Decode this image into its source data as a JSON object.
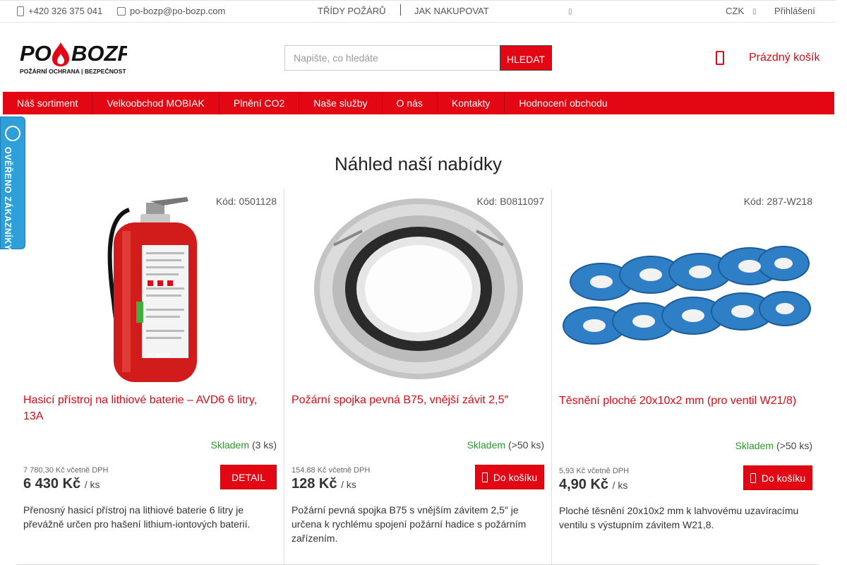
{
  "topbar": {
    "phone": "+420 326 375 041",
    "email": "po-bozp@po-bozp.com",
    "links": [
      "TŘÍDY POŽÁRŮ",
      "JAK NAKUPOVAT"
    ],
    "currency": "CZK",
    "login": "Přihlášení"
  },
  "header": {
    "logo_text": "PO BOZP",
    "logo_tagline": "POŽÁRNÍ OCHRANA | BEZPEČNOST PRÁCE",
    "search_placeholder": "Napište, co hledáte",
    "search_button": "HLEDAT",
    "cart_text": "Prázdný košík"
  },
  "nav": {
    "items": [
      "Náš sortiment",
      "Velkoobchod MOBIAK",
      "Plnění CO2",
      "Naše služby",
      "O nás",
      "Kontakty",
      "Hodnocení obchodu"
    ]
  },
  "badge": {
    "text": "OVĚŘENO ZÁKAZNÍKY"
  },
  "section_title": "Náhled naší nabídky",
  "products": [
    {
      "code": "Kód: 0501128",
      "name": "Hasicí přístroj na lithiové baterie – AVD6 6 litry, 13A",
      "stock_status": "Skladem",
      "stock_qty": "(3 ks)",
      "price_with_vat": "7 780,30 Kč včetně DPH",
      "price": "6 430 Kč",
      "unit": "/ ks",
      "button": "DETAIL",
      "description": "Přenosný hasicí přístroj na lithiové baterie 6 litry je převážně určen pro hašení lithium-iontových baterií.",
      "image": "fire-extinguisher"
    },
    {
      "code": "Kód: B0811097",
      "name": "Požární spojka pevná B75, vnější závit 2,5″",
      "stock_status": "Skladem",
      "stock_qty": "(>50 ks)",
      "price_with_vat": "154,88 Kč včetně DPH",
      "price": "128 Kč",
      "unit": "/ ks",
      "button": "Do košíku",
      "description": "Požární pevná spojka B75 s vnějším závitem 2,5″ je určena k rychlému spojení požární hadice s požárním zařízením.",
      "image": "hose-coupling"
    },
    {
      "code": "Kód: 287-W218",
      "name": "Těsnění ploché 20x10x2 mm (pro ventil W21/8)",
      "stock_status": "Skladem",
      "stock_qty": "(>50 ks)",
      "price_with_vat": "5,93 Kč včetně DPH",
      "price": "4,90 Kč",
      "unit": "/ ks",
      "button": "Do košíku",
      "description": "Ploché těsnění 20x10x2 mm k lahvovému uzavíracímu ventilu s výstupním závitem W21,8.",
      "image": "flat-gaskets"
    }
  ],
  "colors": {
    "brand_red": "#e30613",
    "badge_blue": "#2f9fd9",
    "stock_green": "#2a9a2a"
  }
}
